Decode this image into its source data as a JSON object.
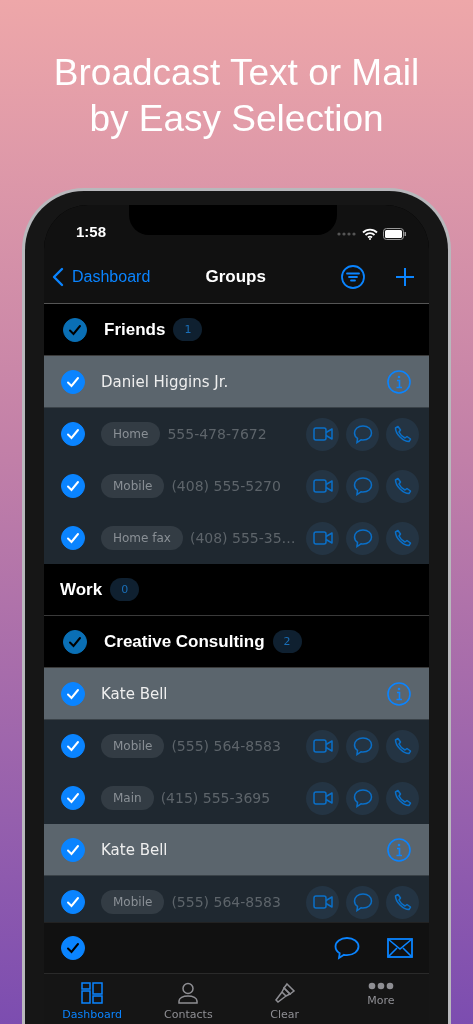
{
  "headline": [
    "Broadcast Text or Mail",
    "by Easy Selection"
  ],
  "status_bar": {
    "time": "1:58"
  },
  "nav": {
    "back": "Dashboard",
    "title": "Groups"
  },
  "groups": [
    {
      "kind": "selectable",
      "checked": true,
      "name": "Friends",
      "count": "1",
      "contacts": [
        {
          "name": "Daniel Higgins Jr.",
          "checked": true,
          "phones": [
            {
              "label": "Home",
              "number": "555-478-7672",
              "checked": true
            },
            {
              "label": "Mobile",
              "number": "(408) 555-5270",
              "checked": true
            },
            {
              "label": "Home fax",
              "number": "(408) 555-35…",
              "checked": true
            }
          ]
        }
      ]
    },
    {
      "kind": "plain",
      "name": "Work",
      "count": "0"
    },
    {
      "kind": "selectable",
      "checked": true,
      "name": "Creative Consulting",
      "count": "2",
      "contacts": [
        {
          "name": "Kate Bell",
          "checked": true,
          "phones": [
            {
              "label": "Mobile",
              "number": "(555) 564-8583",
              "checked": true
            },
            {
              "label": "Main",
              "number": "(415) 555-3695",
              "checked": true
            }
          ]
        },
        {
          "name": "Kate Bell",
          "checked": true,
          "phones": [
            {
              "label": "Mobile",
              "number": "(555) 564-8583",
              "checked": true
            }
          ]
        }
      ]
    }
  ],
  "footer": {
    "checked": true
  },
  "tabs": [
    {
      "label": "Dashboard",
      "selected": true
    },
    {
      "label": "Contacts",
      "selected": false
    },
    {
      "label": "Clear",
      "selected": false
    },
    {
      "label": "More",
      "selected": false
    }
  ]
}
